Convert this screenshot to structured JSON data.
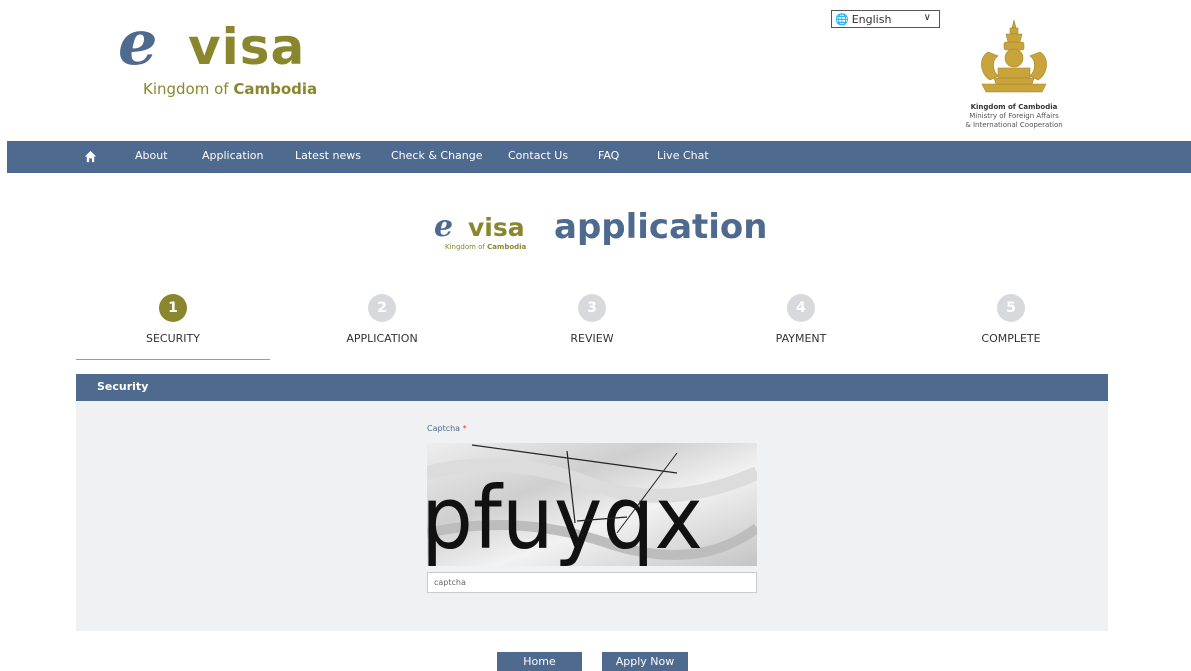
{
  "header": {
    "logo_e": "e",
    "logo_visa": "visa",
    "logo_kingdom_prefix": "Kingdom of",
    "logo_kingdom_bold": "Cambodia",
    "language": "English",
    "ministry": {
      "line1": "Kingdom of Cambodia",
      "line2": "Ministry of Foreign Affairs",
      "line3": "& International Cooperation"
    }
  },
  "nav": {
    "items": [
      "About",
      "Application",
      "Latest news",
      "Check & Change",
      "Contact Us",
      "FAQ",
      "Live Chat"
    ]
  },
  "title": {
    "small_e": "e",
    "small_visa": "visa",
    "small_kingdom_prefix": "Kingdom of",
    "small_kingdom_bold": "Cambodia",
    "text": "application"
  },
  "steps": [
    {
      "number": "1",
      "label": "SECURITY",
      "active": true
    },
    {
      "number": "2",
      "label": "APPLICATION",
      "active": false
    },
    {
      "number": "3",
      "label": "REVIEW",
      "active": false
    },
    {
      "number": "4",
      "label": "PAYMENT",
      "active": false
    },
    {
      "number": "5",
      "label": "COMPLETE",
      "active": false
    }
  ],
  "section": {
    "title": "Security",
    "captcha_label": "Captcha",
    "captcha_required_mark": "*",
    "captcha_text": "pfuyqx",
    "captcha_placeholder": "captcha"
  },
  "buttons": {
    "home": "Home",
    "apply": "Apply Now"
  },
  "colors": {
    "primary": "#4e6a8e",
    "gold": "#8a862e",
    "panel": "#f0f1f3"
  }
}
